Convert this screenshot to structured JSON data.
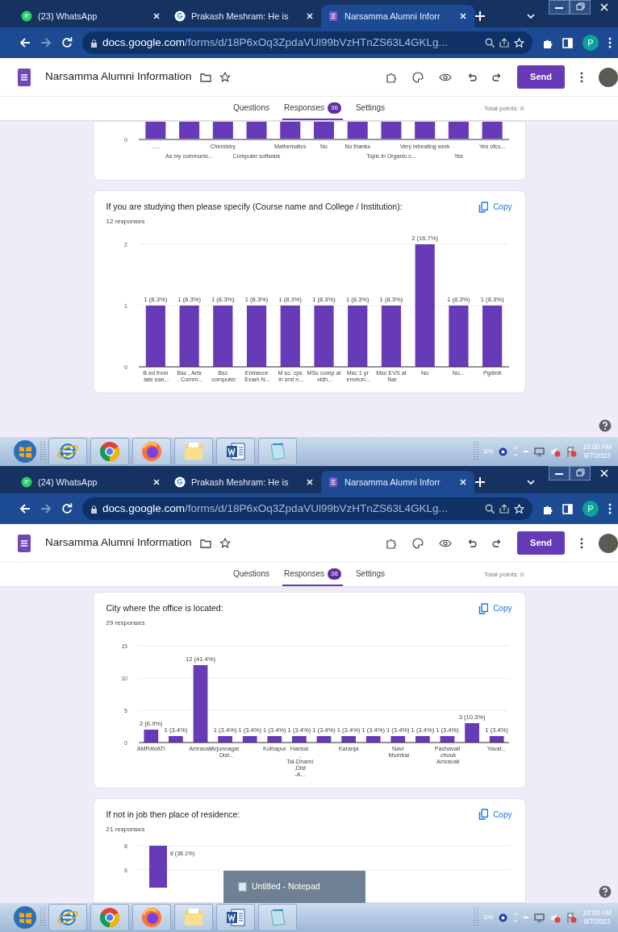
{
  "screens": [
    {
      "browser_tabs": [
        {
          "title": "(23) WhatsApp",
          "selected": false
        },
        {
          "title": "Prakash Meshram: He is",
          "selected": false
        },
        {
          "title": "Narsamma Alumni Inforr",
          "selected": true
        }
      ],
      "address": {
        "domain": "docs.google.com",
        "path": "/forms/d/18P6xOq3ZpdaVUl99bVzHTnZS63L4GKLg..."
      },
      "profile_letter": "P",
      "form_title": "Narsamma Alumni Information",
      "send_label": "Send",
      "form_tabs": [
        {
          "label": "Questions",
          "selected": false
        },
        {
          "label": "Responses",
          "badge": "36",
          "selected": true
        },
        {
          "label": "Settings",
          "selected": false
        }
      ],
      "total_points": "Total points: 0",
      "cards": [
        {
          "kind": "fragment",
          "axis_label": "0",
          "bar_labels": [
            ".....",
            "As my communic...",
            "Chemistry",
            "Computer software",
            "Mathematics",
            "No",
            "No thanks",
            "Topic in Organic c...",
            "Very intreating work",
            "Yes",
            "Yes ofco..."
          ]
        },
        {
          "kind": "chart",
          "question": "If you are studying then please specify (Course name and College / Institution):",
          "copy_label": "Copy",
          "responses": "12 responses",
          "chart_data": {
            "type": "bar",
            "categories": [
              "B ed from late san...",
              "Bsc , Arts , Comm...",
              "Bsc computer",
              "Entrance Exam N...",
              "M sc. cps in smt n...",
              "MSc comp at vidh...",
              "Msc 1 yr environ...",
              "Msc EVS at Nar",
              "No",
              "No...",
              "Pgdmlt"
            ],
            "values": [
              1,
              1,
              1,
              1,
              1,
              1,
              1,
              1,
              2,
              1,
              1
            ],
            "yticks": [
              0,
              1,
              2
            ],
            "ylim": [
              0,
              2
            ],
            "value_labels": [
              "1 (8.3%)",
              "1 (8.3%)",
              "1 (8.3%)",
              "1 (8.3%)",
              "1 (8.3%)",
              "1 (8.3%)",
              "1 (8.3%)",
              "1 (8.3%)",
              "2 (16.7%)",
              "1 (8.3%)",
              "1 (8.3%)"
            ]
          }
        }
      ],
      "taskbar": {
        "lang": "EN",
        "time": "10:00 AM",
        "date": "9/7/2023"
      }
    },
    {
      "browser_tabs": [
        {
          "title": "(24) WhatsApp",
          "selected": false
        },
        {
          "title": "Prakash Meshram: He is",
          "selected": false
        },
        {
          "title": "Narsamma Alumni Inforr",
          "selected": true
        }
      ],
      "address": {
        "domain": "docs.google.com",
        "path": "/forms/d/18P6xOq3ZpdaVUl99bVzHTnZS63L4GKLg..."
      },
      "profile_letter": "P",
      "form_title": "Narsamma Alumni Information",
      "send_label": "Send",
      "form_tabs": [
        {
          "label": "Questions",
          "selected": false
        },
        {
          "label": "Responses",
          "badge": "36",
          "selected": true
        },
        {
          "label": "Settings",
          "selected": false
        }
      ],
      "total_points": "Total points: 0",
      "cards": [
        {
          "kind": "chart",
          "question": "City where the office is located:",
          "copy_label": "Copy",
          "responses": "29 responses",
          "chart_data": {
            "type": "bar",
            "categories": [
              "AMRAVATI",
              null,
              "Amravati",
              "Arjunnagar Dist..",
              null,
              "Kolhapur",
              "Harisal , Tal-Dharni ,Dist -A...",
              null,
              "Karanja",
              null,
              "Navi Mumbai",
              null,
              "Pachavati chouk Amravati",
              null,
              "Yavat..."
            ],
            "values": [
              2,
              1,
              12,
              1,
              1,
              1,
              1,
              1,
              1,
              1,
              1,
              1,
              1,
              3,
              1
            ],
            "yticks": [
              0,
              5,
              10,
              15
            ],
            "ylim": [
              0,
              15
            ],
            "value_labels": [
              "2 (6.9%)",
              "1 (3.4%)",
              "12 (41.4%)",
              "1 (3.4%)",
              "1 (3.4%)",
              "1 (3.4%)",
              "1 (3.4%)",
              "1 (3.4%)",
              "1 (3.4%)",
              "1 (3.4%)",
              "1 (3.4%)",
              "1 (3.4%)",
              "1 (3.4%)",
              "3 (10.3%)",
              "1 (3.4%)"
            ]
          }
        },
        {
          "kind": "partial",
          "question": "If not in job then place of residence:",
          "copy_label": "Copy",
          "responses": "21 responses",
          "ticks": [
            "8",
            "6"
          ],
          "bar_label": "8 (38.1%)"
        }
      ],
      "notepad_popup": "Untitled - Notepad",
      "taskbar": {
        "lang": "EN",
        "time": "10:03 AM",
        "date": "9/7/2023"
      }
    }
  ]
}
